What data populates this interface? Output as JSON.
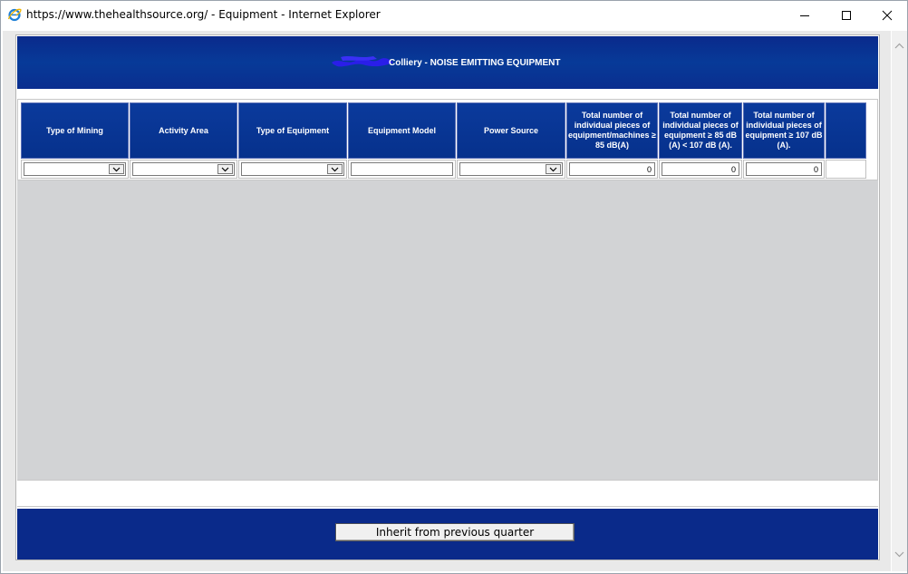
{
  "window": {
    "title": "https://www.thehealthsource.org/ - Equipment - Internet Explorer",
    "browser_icon": "ie-icon",
    "controls": [
      "minimize-icon",
      "maximize-icon",
      "close-icon"
    ]
  },
  "header": {
    "title": "Colliery - NOISE EMITTING EQUIPMENT",
    "accent": "#0a2a8c"
  },
  "table": {
    "columns": [
      "Type of Mining",
      "Activity Area",
      "Type of Equipment",
      "Equipment Model",
      "Power Source",
      "Total number of individual pieces of equipment/machines ≥ 85 dB(A)",
      "Total number of individual pieces of equipment ≥ 85 dB (A) < 107 dB (A).",
      "Total number of individual pieces of equipment ≥ 107 dB (A)."
    ],
    "row": {
      "type_of_mining": "",
      "activity_area": "",
      "type_of_equipment": "",
      "equipment_model": "",
      "power_source": "",
      "count_85": "0",
      "count_85_107": "0",
      "count_107": "0"
    }
  },
  "footer": {
    "inherit_button": "Inherit from previous quarter"
  },
  "colors": {
    "band_blue": "#0a2a8a",
    "content_grey": "#d2d3d5"
  }
}
